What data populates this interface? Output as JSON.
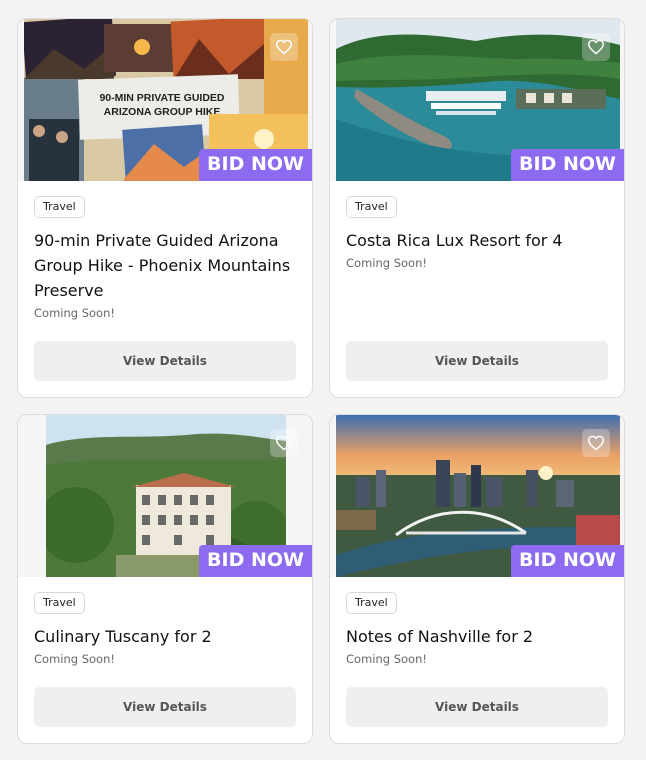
{
  "cards": [
    {
      "badge": "BID NOW",
      "category": "Travel",
      "title": "90-min Private Guided Arizona Group Hike - Phoenix Mountains Preserve",
      "status": "Coming Soon!",
      "button": "View Details",
      "image_text": [
        "90-MIN PRIVATE GUIDED",
        "ARIZONA GROUP HIKE"
      ],
      "favorite_icon": "heart-outline-icon"
    },
    {
      "badge": "BID NOW",
      "category": "Travel",
      "title": "Costa Rica Lux Resort for 4",
      "status": "Coming Soon!",
      "button": "View Details",
      "favorite_icon": "heart-outline-icon"
    },
    {
      "badge": "BID NOW",
      "category": "Travel",
      "title": "Culinary Tuscany for 2",
      "status": "Coming Soon!",
      "button": "View Details",
      "favorite_icon": "heart-outline-icon"
    },
    {
      "badge": "BID NOW",
      "category": "Travel",
      "title": "Notes of Nashville for 2",
      "status": "Coming Soon!",
      "button": "View Details",
      "favorite_icon": "heart-outline-icon"
    }
  ],
  "colors": {
    "badge": "#8d6bf0",
    "button_bg": "#efefef",
    "page_bg": "#f3f3f3"
  }
}
